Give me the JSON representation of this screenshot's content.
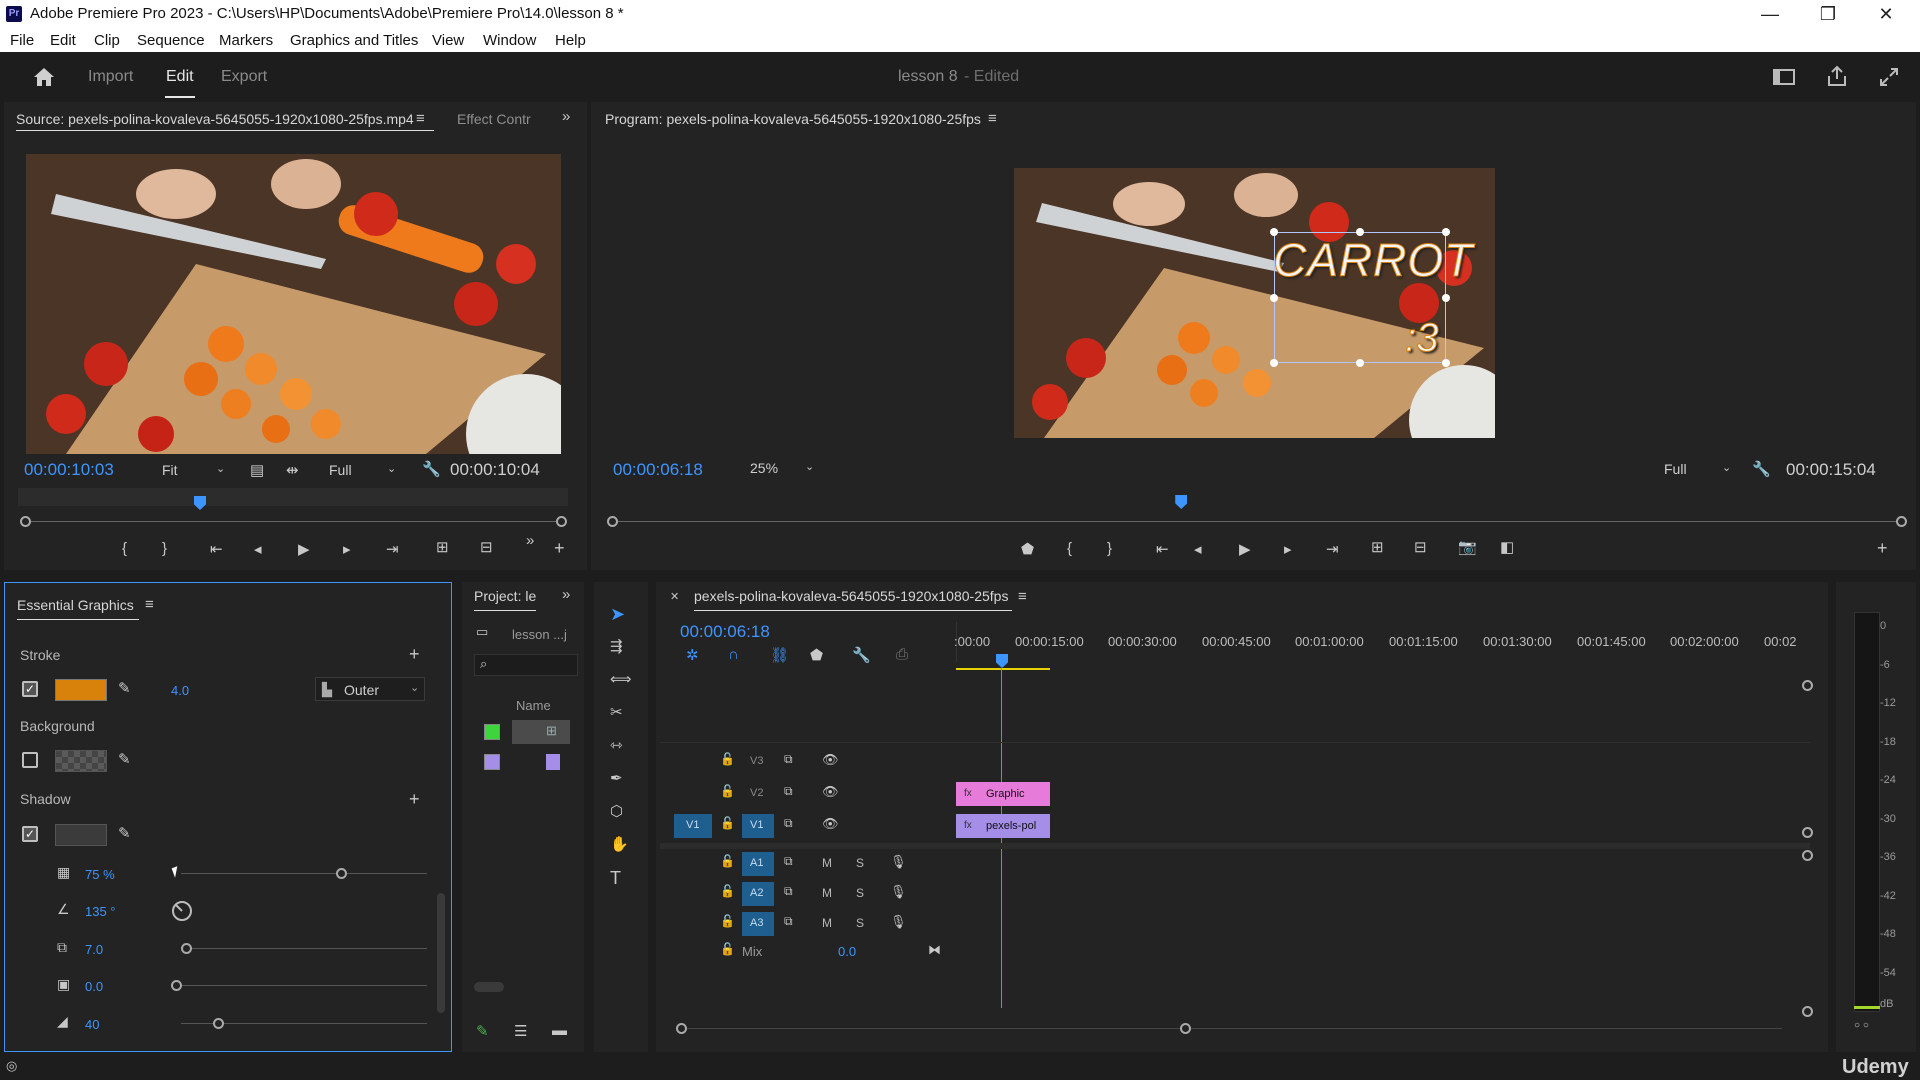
{
  "window": {
    "title": "Adobe Premiere Pro 2023 - C:\\Users\\HP\\Documents\\Adobe\\Premiere Pro\\14.0\\lesson 8 *",
    "minimize": "—",
    "maximize": "❐",
    "close": "✕"
  },
  "menu": [
    "File",
    "Edit",
    "Clip",
    "Sequence",
    "Markers",
    "Graphics and Titles",
    "View",
    "Window",
    "Help"
  ],
  "header": {
    "tabs": [
      "Import",
      "Edit",
      "Export"
    ],
    "active_tab": "Edit",
    "project": "lesson 8",
    "status": "- Edited"
  },
  "source": {
    "tab": "Source: pexels-polina-kovaleva-5645055-1920x1080-25fps.mp4",
    "tab2": "Effect Contr",
    "timecode_in": "00:00:10:03",
    "fit": "Fit",
    "quality": "Full",
    "duration": "00:00:10:04",
    "playhead_fraction": 0.32
  },
  "program": {
    "tab": "Program: pexels-polina-kovaleva-5645055-1920x1080-25fps",
    "timecode": "00:00:06:18",
    "zoom": "25%",
    "quality": "Full",
    "duration": "00:00:15:04",
    "overlay_text": "CARROT",
    "overlay_sub": ":3",
    "playhead_fraction": 0.44
  },
  "essential_graphics": {
    "title": "Essential Graphics",
    "stroke_label": "Stroke",
    "stroke_color": "#d9820b",
    "stroke_width": "4.0",
    "stroke_type": "Outer",
    "background_label": "Background",
    "shadow_label": "Shadow",
    "shadow_opacity": "75 %",
    "shadow_angle": "135 °",
    "shadow_distance": "7.0",
    "shadow_size": "0.0",
    "shadow_blur": "40",
    "shadow_opacity_level": 0.75
  },
  "project": {
    "tab": "Project: le",
    "item": "lesson ...j",
    "column": "Name"
  },
  "timeline": {
    "tab": "pexels-polina-kovaleva-5645055-1920x1080-25fps",
    "timecode": "00:00:06:18",
    "ruler": [
      ":00:00",
      "00:00:15:00",
      "00:00:30:00",
      "00:00:45:00",
      "00:01:00:00",
      "00:01:15:00",
      "00:01:30:00",
      "00:01:45:00",
      "00:02:00:00",
      "00:02"
    ],
    "tracks_video": [
      "V3",
      "V2",
      "V1"
    ],
    "tracks_audio": [
      "A1",
      "A2",
      "A3"
    ],
    "source_patch": "V1",
    "mix_label": "Mix",
    "mix_value": "0.0",
    "m_label": "M",
    "s_label": "S",
    "clips": [
      {
        "name": "Graphic",
        "track": "V2",
        "color": "#e67bd9"
      },
      {
        "name": "pexels-pol",
        "track": "V1",
        "color": "#a48ee8"
      }
    ]
  },
  "meter": {
    "scale": [
      "0",
      "-6",
      "-12",
      "-18",
      "-24",
      "-30",
      "-36",
      "-42",
      "-48",
      "-54",
      "dB"
    ]
  },
  "watermark": "Udemy"
}
